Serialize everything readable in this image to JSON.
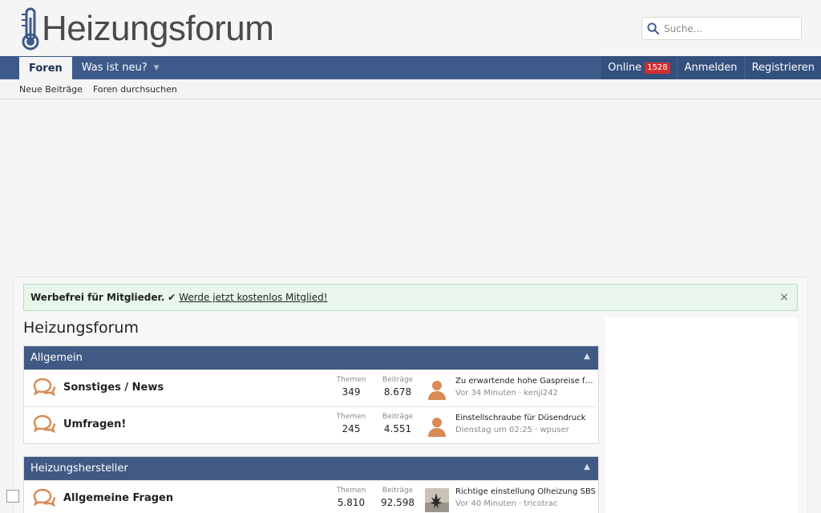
{
  "header": {
    "logo_text": "Heizungsforum",
    "search": {
      "placeholder": "Suche..."
    }
  },
  "nav": {
    "tabs": [
      {
        "label": "Foren"
      },
      {
        "label": "Was ist neu?"
      }
    ],
    "right": {
      "online_label": "Online",
      "online_count": "1528",
      "login": "Anmelden",
      "register": "Registrieren"
    }
  },
  "subnav": {
    "items": [
      {
        "label": "Neue Beiträge"
      },
      {
        "label": "Foren durchsuchen"
      }
    ]
  },
  "notice": {
    "bold": "Werbefrei für Mitglieder.",
    "check": "✔",
    "link": "Werde jetzt kostenlos Mitglied!",
    "close": "×"
  },
  "page_title": "Heizungsforum",
  "stat_labels": {
    "threads": "Themen",
    "posts": "Beiträge"
  },
  "categories": [
    {
      "title": "Allgemein",
      "forums": [
        {
          "title": "Sonstiges / News",
          "threads": "349",
          "posts": "8.678",
          "last_thread": "Zu erwartende hohe Gaspreise für...",
          "last_meta": "Vor 34 Minuten · kenji242",
          "avatar": "default"
        },
        {
          "title": "Umfragen!",
          "threads": "245",
          "posts": "4.551",
          "last_thread": "Einstellschraube für Düsendruck",
          "last_meta": "Dienstag um 02:25 · wpuser",
          "avatar": "default"
        }
      ]
    },
    {
      "title": "Heizungshersteller",
      "forums": [
        {
          "title": "Allgemeine Fragen",
          "threads": "5.810",
          "posts": "92.598",
          "last_thread": "Richtige einstellung Ölheizung SBS",
          "last_meta": "Vor 40 Minuten · tricotrac",
          "avatar": "photo"
        }
      ]
    }
  ],
  "colors": {
    "nav": "#3d5a8a",
    "block_head": "#415a85",
    "forum_icon": "#d98a55",
    "badge": "#d42e2e",
    "notice_bg": "#e8f6ec"
  }
}
